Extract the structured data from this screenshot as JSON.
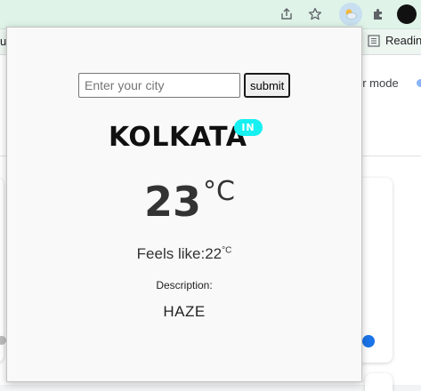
{
  "browser": {
    "bookmark_reading": "Readin",
    "page_mode_text": "er mode",
    "left_fragment": "u"
  },
  "popup": {
    "search": {
      "placeholder": "Enter your city",
      "value": ""
    },
    "submit_label": "submit",
    "city": "KOLKATA",
    "country_code": "IN",
    "temperature": "23",
    "temp_unit": "°C",
    "feels_like_label": "Feels like:",
    "feels_like_value": "22",
    "feels_like_unit": "°C",
    "description_label": "Description:",
    "description_value": "HAZE",
    "badge_color": "#17f0f0"
  }
}
